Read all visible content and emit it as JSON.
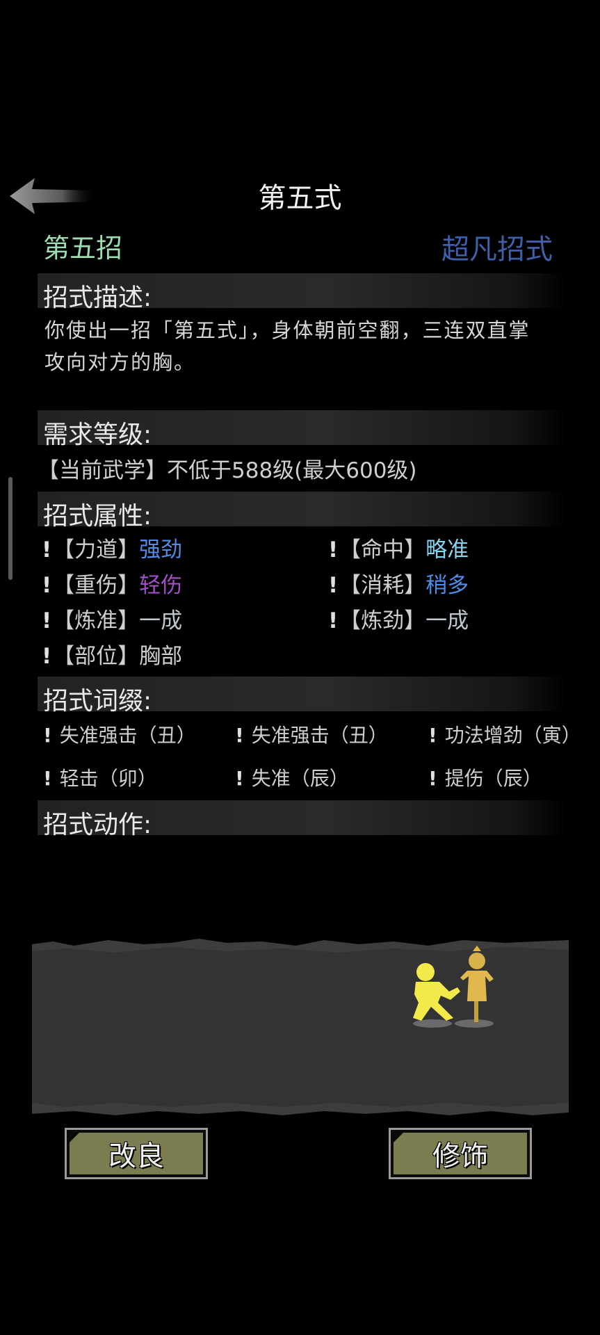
{
  "header": {
    "title": "第五式"
  },
  "move": {
    "name": "第五招",
    "grade": "超凡招式"
  },
  "sections": {
    "description": "招式描述:",
    "requirement": "需求等级:",
    "attributes": "招式属性:",
    "affixes": "招式词缀:",
    "animation": "招式动作:"
  },
  "description_text": "你使出一招「第五式」，身体朝前空翻，三连双直掌攻向对方的胸。",
  "requirement_text": "【当前武学】不低于588级(最大600级)",
  "attributes": [
    {
      "key": "【力道】",
      "value": "强劲",
      "color": "#4f8de8"
    },
    {
      "key": "【命中】",
      "value": "略准",
      "color": "#8ad4ee"
    },
    {
      "key": "【重伤】",
      "value": "轻伤",
      "color": "#a04fc8"
    },
    {
      "key": "【消耗】",
      "value": "稍多",
      "color": "#4f8de8"
    },
    {
      "key": "【炼准】",
      "value": "一成",
      "color": "#bfc7cf"
    },
    {
      "key": "【炼劲】",
      "value": "一成",
      "color": "#bfc7cf"
    },
    {
      "key": "【部位】",
      "value": "胸部",
      "color": "#cfcfcf"
    }
  ],
  "affixes": [
    "失准强击（丑）",
    "失准强击（丑）",
    "功法增劲（寅）",
    "轻击（卯）",
    "失准（辰）",
    "提伤（辰）"
  ],
  "buttons": {
    "improve": "改良",
    "decorate": "修饰"
  },
  "bang": "!"
}
